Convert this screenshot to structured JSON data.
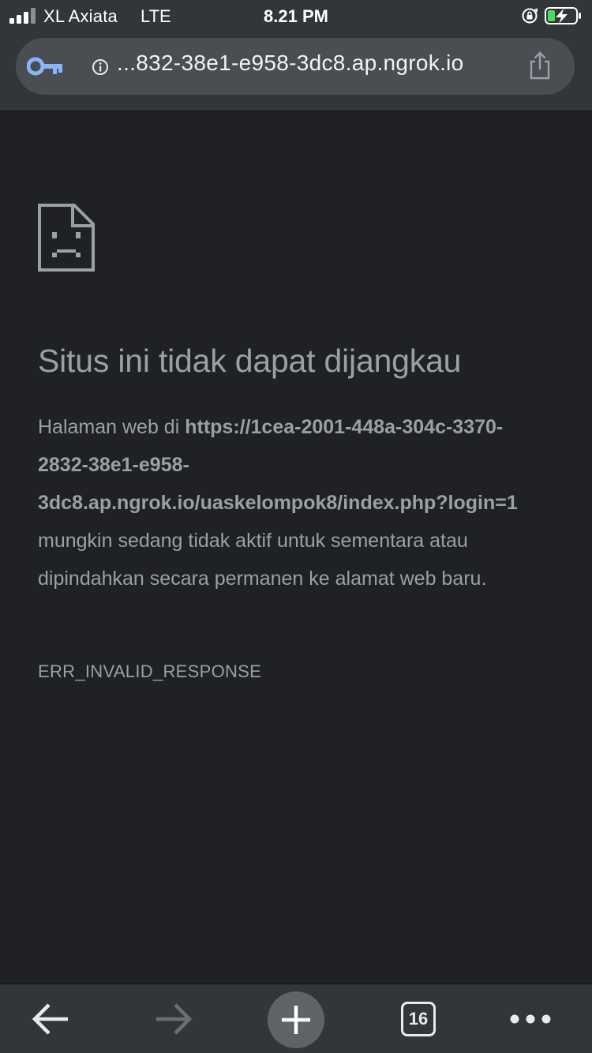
{
  "status_bar": {
    "carrier": "XL Axiata",
    "network": "LTE",
    "time": "8.21 PM",
    "battery_state": "charging",
    "battery_color": "#4cd964"
  },
  "toolbar": {
    "url": "...832-38e1-e958-3dc8.ap.ngrok.io",
    "icons": [
      "key-icon",
      "info-icon",
      "share-icon"
    ],
    "key_icon_color": "#8ab4f8"
  },
  "error_page": {
    "icon": "sad-page-icon",
    "title": "Situs ini tidak dapat dijangkau",
    "body_prefix": "Halaman web di ",
    "body_url": "https://1cea-2001-448a-304c-3370-2832-38e1-e958-3dc8.ap.ngrok.io/uaskelompok8/index.php?login=1",
    "body_suffix": " mungkin sedang tidak aktif untuk sementara atau dipindahkan secara permanen ke alamat web baru.",
    "error_code": "ERR_INVALID_RESPONSE"
  },
  "bottom_bar": {
    "tab_count": "16",
    "buttons": [
      "back-arrow-icon",
      "forward-arrow-icon",
      "plus-icon",
      "tab-switcher",
      "more-dots-icon"
    ]
  },
  "colors": {
    "background": "#202124",
    "toolbar": "#323639",
    "url_pill": "#4a4d51",
    "text_muted": "#9aa0a6"
  }
}
